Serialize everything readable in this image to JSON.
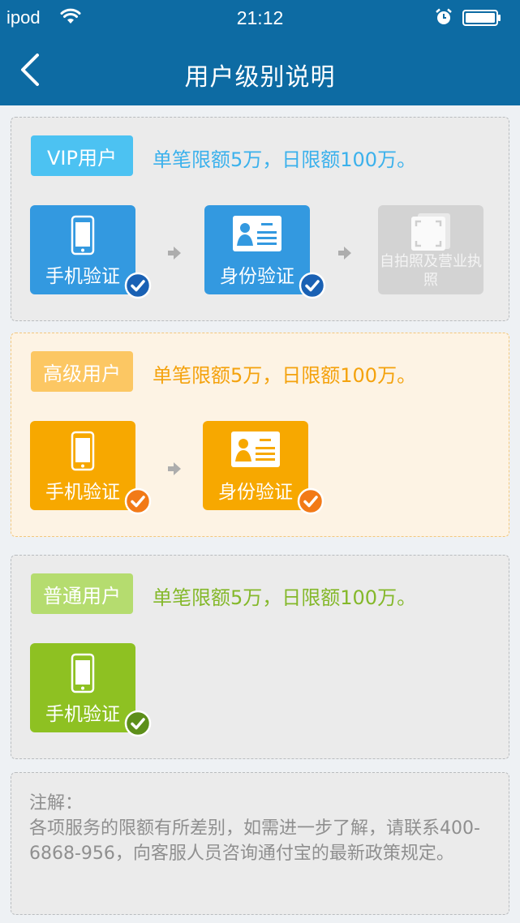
{
  "status_bar": {
    "carrier": "ipod",
    "time": "21:12",
    "icons": [
      "wifi-icon",
      "alarm-icon",
      "battery-icon"
    ]
  },
  "nav": {
    "back_icon": "chevron-left-icon",
    "title": "用户级别说明"
  },
  "colors": {
    "nav_bg": "#0d6ba3",
    "vip": "#3399e0",
    "senior": "#f7a800",
    "normal": "#8ec122"
  },
  "levels": [
    {
      "tag": "VIP用户",
      "limit": "单笔限额5万，日限额100万。",
      "steps": [
        {
          "label": "手机验证",
          "icon": "phone-icon",
          "verified": true
        },
        {
          "label": "身份验证",
          "icon": "id-card-icon",
          "verified": true
        },
        {
          "label": "自拍照及营业执照",
          "icon": "scan-photo-icon",
          "verified": false
        }
      ]
    },
    {
      "tag": "高级用户",
      "limit": "单笔限额5万，日限额100万。",
      "steps": [
        {
          "label": "手机验证",
          "icon": "phone-icon",
          "verified": true
        },
        {
          "label": "身份验证",
          "icon": "id-card-icon",
          "verified": true
        }
      ]
    },
    {
      "tag": "普通用户",
      "limit": "单笔限额5万，日限额100万。",
      "steps": [
        {
          "label": "手机验证",
          "icon": "phone-icon",
          "verified": true
        }
      ]
    }
  ],
  "note": {
    "title": "注解：",
    "body": "各项服务的限额有所差别，如需进一步了解，请联系400-6868-956，向客服人员咨询通付宝的最新政策规定。"
  }
}
